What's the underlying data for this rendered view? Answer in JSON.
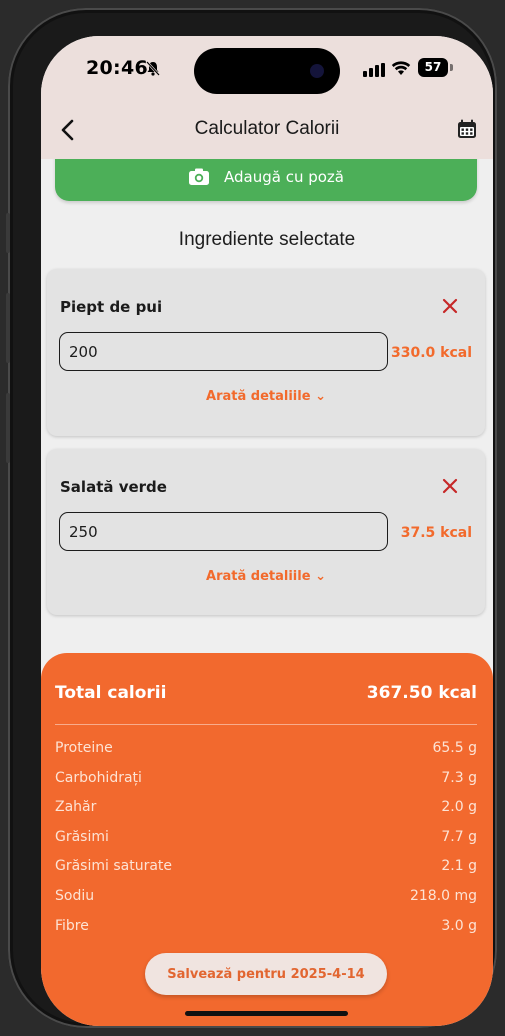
{
  "status_bar": {
    "time": "20:46",
    "battery": "57",
    "icons": [
      "bell-slash-icon",
      "cellular-signal-icon",
      "wifi-icon",
      "battery-icon"
    ]
  },
  "header": {
    "title": "Calculator Calorii",
    "back_icon": "chevron-left-icon",
    "calendar_icon": "calendar-icon"
  },
  "add_photo": {
    "label": "Adaugă cu poză",
    "icon": "camera-icon"
  },
  "ingredients_title": "Ingrediente selectate",
  "ingredients": [
    {
      "name": "Piept de pui",
      "quantity": "200",
      "kcal": "330.0 kcal",
      "details_label": "Arată detaliile ⌄"
    },
    {
      "name": "Salată verde",
      "quantity": "250",
      "kcal": "37.5 kcal",
      "details_label": "Arată detaliile ⌄"
    }
  ],
  "totals": {
    "label": "Total calorii",
    "value": "367.50 kcal",
    "nutrients": [
      {
        "name": "Proteine",
        "value": "65.5 g"
      },
      {
        "name": "Carbohidrați",
        "value": "7.3 g"
      },
      {
        "name": "Zahăr",
        "value": "2.0 g"
      },
      {
        "name": "Grăsimi",
        "value": "7.7 g"
      },
      {
        "name": "Grăsimi saturate",
        "value": "2.1 g"
      },
      {
        "name": "Sodiu",
        "value": "218.0 mg"
      },
      {
        "name": "Fibre",
        "value": "3.0 g"
      }
    ],
    "save_label": "Salvează pentru 2025-4-14"
  },
  "colors": {
    "accent": "#f2692e",
    "green": "#4caf58",
    "delete": "#c62828",
    "header_bg": "#ecdfdc"
  }
}
